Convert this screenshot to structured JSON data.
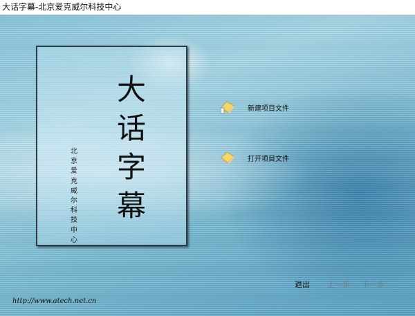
{
  "window": {
    "title": "大话字幕-北京爱克威尔科技中心"
  },
  "cover": {
    "title_chars": [
      "大",
      "话",
      "字",
      "幕"
    ],
    "subtitle": "北京爱克威尔科技中心"
  },
  "actions": [
    {
      "label": "新建项目文件",
      "icon": "new-book-icon"
    },
    {
      "label": "打开项目文件",
      "icon": "open-book-icon"
    }
  ],
  "nav": {
    "exit": "退出",
    "prev": "上一步",
    "next": "下一步"
  },
  "footer": {
    "url": "http://www.atech.net.cn"
  }
}
